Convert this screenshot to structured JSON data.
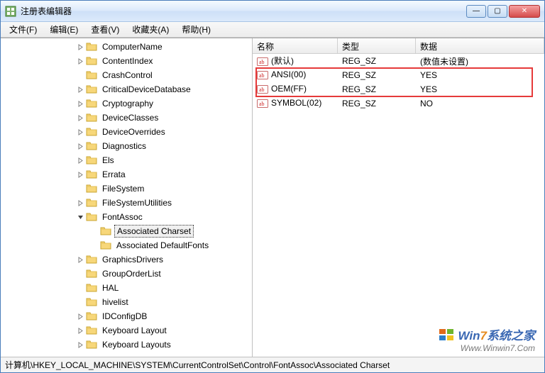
{
  "window": {
    "title": "注册表编辑器"
  },
  "menu": [
    "文件(F)",
    "编辑(E)",
    "查看(V)",
    "收藏夹(A)",
    "帮助(H)"
  ],
  "tree": [
    {
      "label": "ComputerName",
      "indent": "ind-2",
      "expander": "right",
      "selected": false
    },
    {
      "label": "ContentIndex",
      "indent": "ind-2",
      "expander": "right",
      "selected": false
    },
    {
      "label": "CrashControl",
      "indent": "ind-2",
      "expander": "none",
      "selected": false
    },
    {
      "label": "CriticalDeviceDatabase",
      "indent": "ind-2",
      "expander": "right",
      "selected": false
    },
    {
      "label": "Cryptography",
      "indent": "ind-2",
      "expander": "right",
      "selected": false
    },
    {
      "label": "DeviceClasses",
      "indent": "ind-2",
      "expander": "right",
      "selected": false
    },
    {
      "label": "DeviceOverrides",
      "indent": "ind-2",
      "expander": "right",
      "selected": false
    },
    {
      "label": "Diagnostics",
      "indent": "ind-2",
      "expander": "right",
      "selected": false
    },
    {
      "label": "Els",
      "indent": "ind-2",
      "expander": "right",
      "selected": false
    },
    {
      "label": "Errata",
      "indent": "ind-2",
      "expander": "right",
      "selected": false
    },
    {
      "label": "FileSystem",
      "indent": "ind-2",
      "expander": "none",
      "selected": false
    },
    {
      "label": "FileSystemUtilities",
      "indent": "ind-2",
      "expander": "right",
      "selected": false
    },
    {
      "label": "FontAssoc",
      "indent": "ind-2",
      "expander": "down",
      "selected": false
    },
    {
      "label": "Associated Charset",
      "indent": "ind-3",
      "expander": "none",
      "selected": true
    },
    {
      "label": "Associated DefaultFonts",
      "indent": "ind-3",
      "expander": "none",
      "selected": false
    },
    {
      "label": "GraphicsDrivers",
      "indent": "ind-2",
      "expander": "right",
      "selected": false
    },
    {
      "label": "GroupOrderList",
      "indent": "ind-2",
      "expander": "none",
      "selected": false
    },
    {
      "label": "HAL",
      "indent": "ind-2",
      "expander": "none",
      "selected": false
    },
    {
      "label": "hivelist",
      "indent": "ind-2",
      "expander": "none",
      "selected": false
    },
    {
      "label": "IDConfigDB",
      "indent": "ind-2",
      "expander": "right",
      "selected": false
    },
    {
      "label": "Keyboard Layout",
      "indent": "ind-2",
      "expander": "right",
      "selected": false
    },
    {
      "label": "Keyboard Layouts",
      "indent": "ind-2",
      "expander": "right",
      "selected": false
    }
  ],
  "columns": {
    "name": "名称",
    "type": "类型",
    "data": "数据"
  },
  "values": [
    {
      "name": "(默认)",
      "type": "REG_SZ",
      "data": "(数值未设置)",
      "hl": false
    },
    {
      "name": "ANSI(00)",
      "type": "REG_SZ",
      "data": "YES",
      "hl": true
    },
    {
      "name": "OEM(FF)",
      "type": "REG_SZ",
      "data": "YES",
      "hl": true
    },
    {
      "name": "SYMBOL(02)",
      "type": "REG_SZ",
      "data": "NO",
      "hl": false
    }
  ],
  "status": "计算机\\HKEY_LOCAL_MACHINE\\SYSTEM\\CurrentControlSet\\Control\\FontAssoc\\Associated Charset",
  "watermark": {
    "line1a": "Win",
    "line1b": "7",
    "line1c": "系统之家",
    "line2": "Www.Winwin7.Com"
  },
  "winbuttons": {
    "min": "—",
    "max": "▢",
    "close": "✕"
  }
}
